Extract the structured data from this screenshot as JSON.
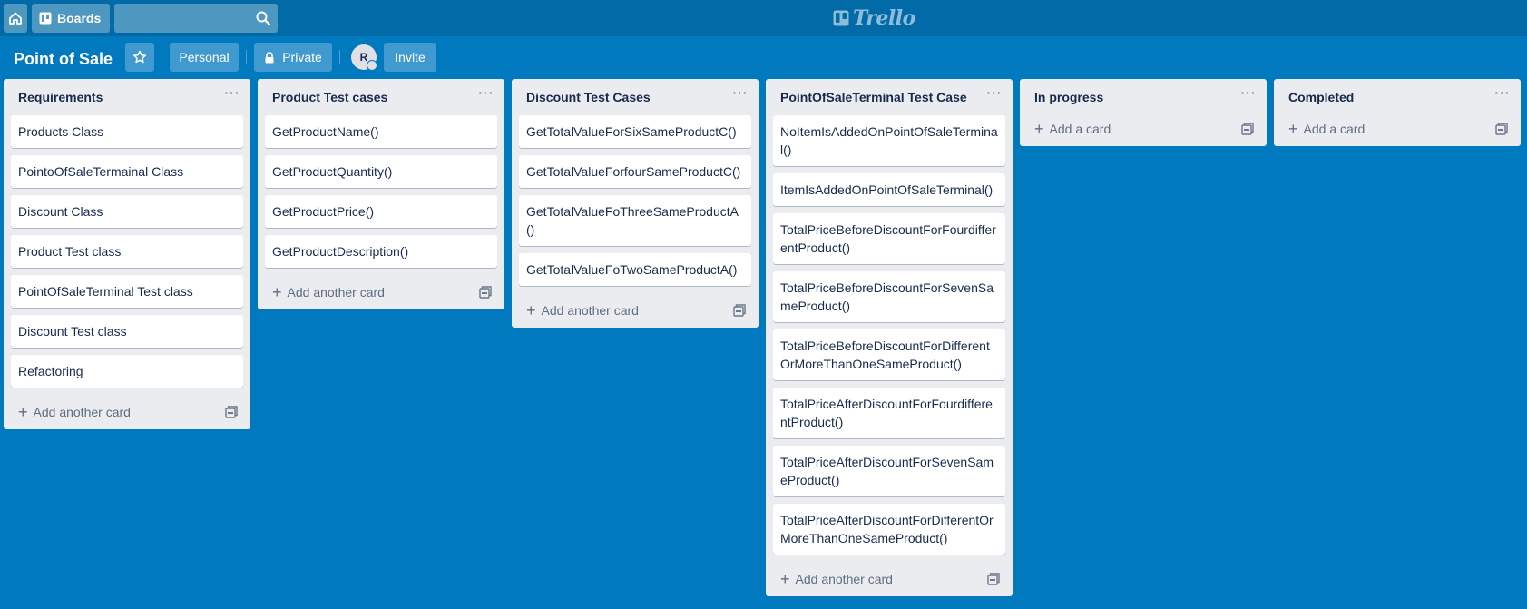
{
  "header": {
    "boards_label": "Boards",
    "search_placeholder": "",
    "logo_text": "Trello"
  },
  "board": {
    "title": "Point of Sale",
    "personal_label": "Personal",
    "private_label": "Private",
    "avatar_initial": "R",
    "invite_label": "Invite"
  },
  "lists": [
    {
      "title": "Requirements",
      "cards": [
        "Products Class",
        "PointoOfSaleTermainal Class",
        "Discount Class",
        "Product Test class",
        "PointOfSaleTerminal Test class",
        "Discount Test class",
        "Refactoring"
      ],
      "add_label": "Add another card"
    },
    {
      "title": "Product Test cases",
      "cards": [
        "GetProductName()",
        "GetProductQuantity()",
        "GetProductPrice()",
        "GetProductDescription()"
      ],
      "add_label": "Add another card"
    },
    {
      "title": "Discount Test Cases",
      "cards": [
        "GetTotalValueForSixSameProductC()",
        "GetTotalValueForfourSameProductC()",
        "GetTotalValueFoThreeSameProductA()",
        "GetTotalValueFoTwoSameProductA()"
      ],
      "add_label": "Add another card"
    },
    {
      "title": "PointOfSaleTerminal Test Case",
      "cards": [
        "NoItemIsAddedOnPointOfSaleTerminal()",
        "ItemIsAddedOnPointOfSaleTerminal()",
        "TotalPriceBeforeDiscountForFourdifferentProduct()",
        "TotalPriceBeforeDiscountForSevenSameProduct()",
        "TotalPriceBeforeDiscountForDifferentOrMoreThanOneSameProduct()",
        "TotalPriceAfterDiscountForFourdifferentProduct()",
        "TotalPriceAfterDiscountForSevenSameProduct()",
        "TotalPriceAfterDiscountForDifferentOrMoreThanOneSameProduct()"
      ],
      "add_label": "Add another card"
    },
    {
      "title": "In progress",
      "cards": [],
      "add_label": "Add a card"
    },
    {
      "title": "Completed",
      "cards": [],
      "add_label": "Add a card"
    }
  ],
  "colors": {
    "board_background": "#0079bf",
    "header_background": "#026aa7",
    "list_background": "#ebecf0"
  }
}
